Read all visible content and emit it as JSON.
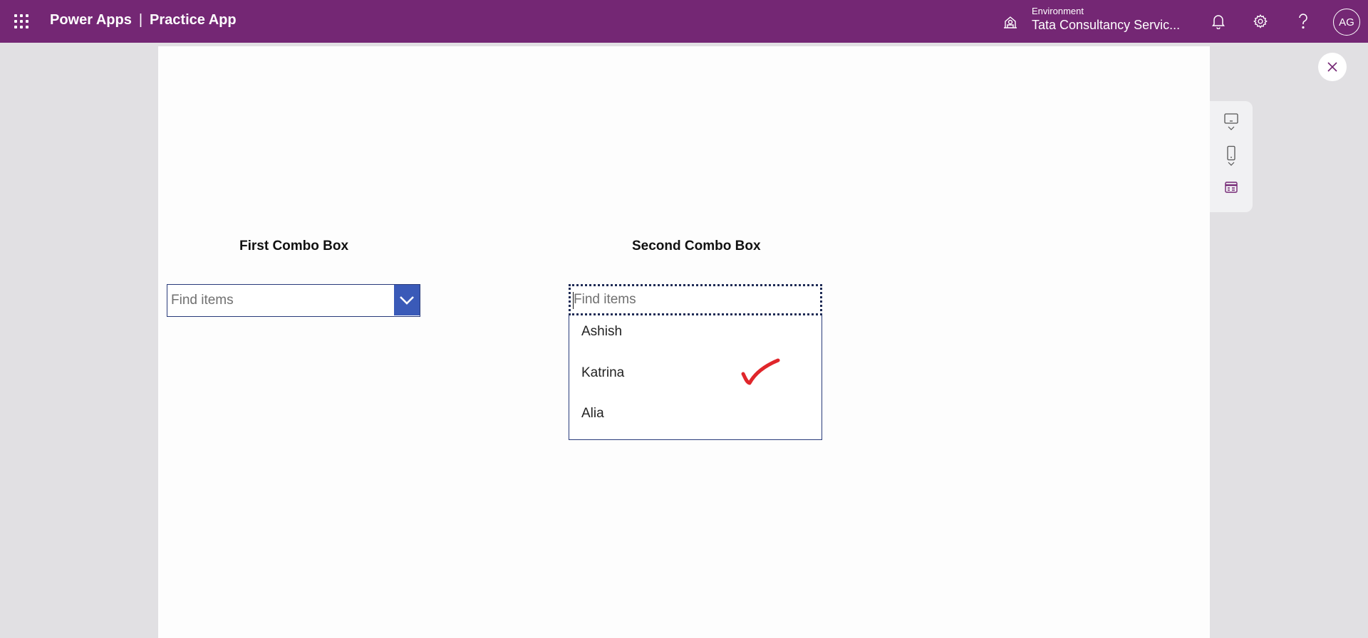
{
  "topbar": {
    "product": "Power Apps",
    "separator": "|",
    "app_name": "Practice App",
    "environment_label": "Environment",
    "environment_name": "Tata Consultancy Servic...",
    "avatar_initials": "AG",
    "icons": [
      "app-launcher-icon",
      "environment-icon",
      "bell-icon",
      "gear-icon",
      "help-icon"
    ]
  },
  "canvas": {
    "first_label": "First Combo Box",
    "second_label": "Second Combo Box",
    "first_combo": {
      "placeholder": "Find items"
    },
    "second_combo": {
      "placeholder": "Find items"
    },
    "dropdown_items": [
      "Ashish",
      "Katrina",
      "Alia"
    ]
  },
  "colors": {
    "topbar": "#742774",
    "combo_border": "#283a7a",
    "chevron_bg": "#3a5ab8",
    "check_mark": "#e0262b"
  }
}
